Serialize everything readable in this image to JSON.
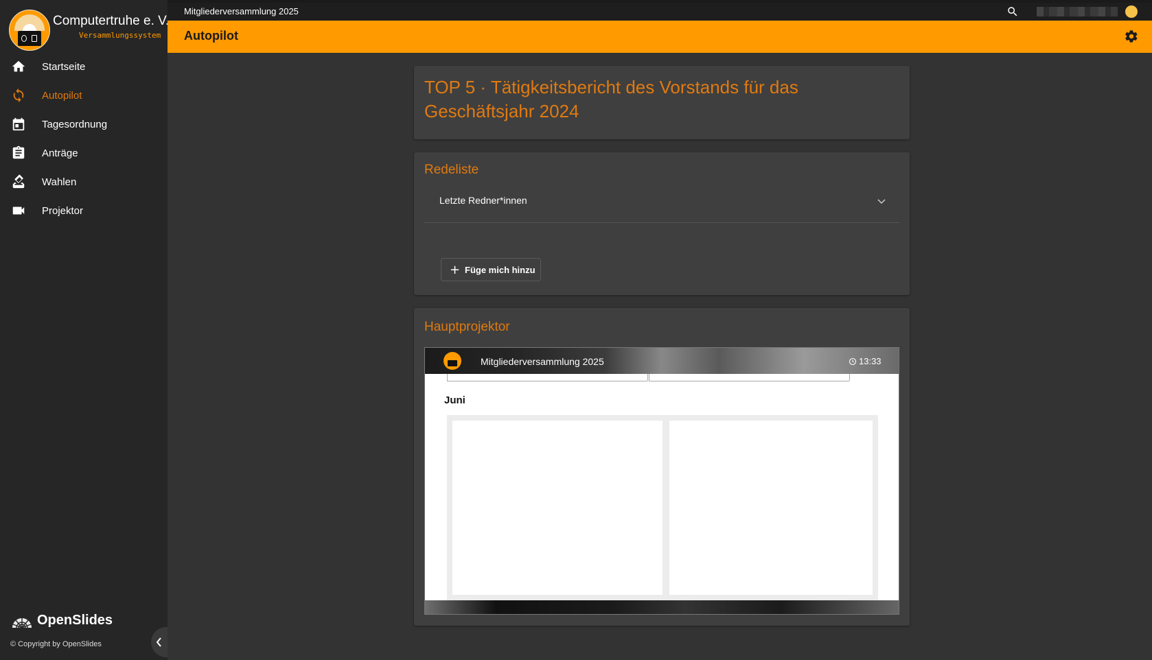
{
  "sidebar": {
    "brand_name": "Computertruhe e. V.",
    "brand_sub": "Versammlungssystem",
    "items": [
      {
        "label": "Startseite",
        "icon": "home-icon",
        "active": false
      },
      {
        "label": "Autopilot",
        "icon": "sync-icon",
        "active": true
      },
      {
        "label": "Tagesordnung",
        "icon": "calendar-icon",
        "active": false
      },
      {
        "label": "Anträge",
        "icon": "clipboard-icon",
        "active": false
      },
      {
        "label": "Wahlen",
        "icon": "ballot-icon",
        "active": false
      },
      {
        "label": "Projektor",
        "icon": "videocam-icon",
        "active": false
      }
    ],
    "footer_brand": "OpenSlides",
    "copyright": "©  Copyright by OpenSlides"
  },
  "topbar": {
    "meeting_name": "Mitgliederversammlung 2025"
  },
  "header": {
    "title": "Autopilot"
  },
  "agenda_card": {
    "title": "TOP 5 · Tätigkeitsbericht des Vorstands für das Geschäftsjahr 2024"
  },
  "speakers_card": {
    "title": "Redeliste",
    "panel_label": "Letzte Redner*innen",
    "add_button": "Füge mich hinzu"
  },
  "projector_card": {
    "title": "Hauptprojektor",
    "slide_header_title": "Mitgliederversammlung 2025",
    "clock": "13:33",
    "slide_heading": "Juni"
  },
  "colors": {
    "accent": "#ff9a00",
    "accent_text": "#e07a10",
    "background": "#333333",
    "sidebar": "#262626",
    "card": "#3f3f3f"
  }
}
